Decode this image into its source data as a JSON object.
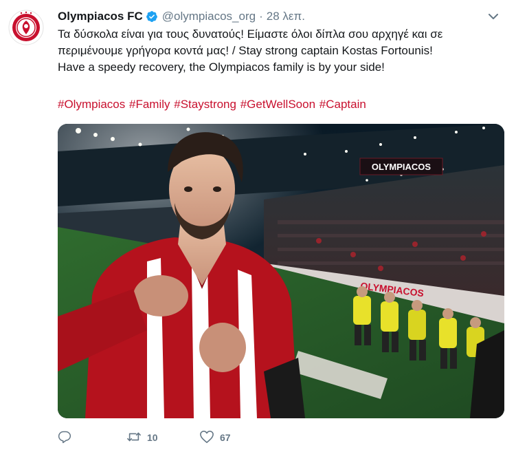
{
  "tweet": {
    "author_name": "Olympiacos FC",
    "handle": "@olympiacos_org",
    "separator": "·",
    "time": "28 λεπ.",
    "text_line_1": "Τα δύσκολα είναι για τους δυνατούς! Είμαστε όλοι δίπλα σου αρχηγέ και σε",
    "text_line_2": "περιμένουμε γρήγορα κοντά μας! / Stay strong captain Kostas Fortounis!",
    "text_line_3": "Have a speedy recovery, the Olympiacos family is by your side!",
    "hashtags": [
      "#Olympiacos",
      "#Family",
      "#Staystrong",
      "#GetWellSoon",
      "#Captain"
    ],
    "photo": {
      "stadium_sign": "OLYMPIACOS",
      "banner_text": "OLYMPIACOS"
    },
    "actions": {
      "reply_count": "",
      "retweet_count": "10",
      "like_count": "67"
    }
  },
  "icons": {
    "avatar": "olympiacos-crest-icon",
    "verified": "verified-badge-icon",
    "caret": "chevron-down-icon",
    "reply": "reply-icon",
    "retweet": "retweet-icon",
    "like": "heart-icon"
  },
  "colors": {
    "brand_red": "#c8102e",
    "verified_blue": "#1da1f2",
    "muted_text": "#657786",
    "primary_text": "#14171a"
  }
}
